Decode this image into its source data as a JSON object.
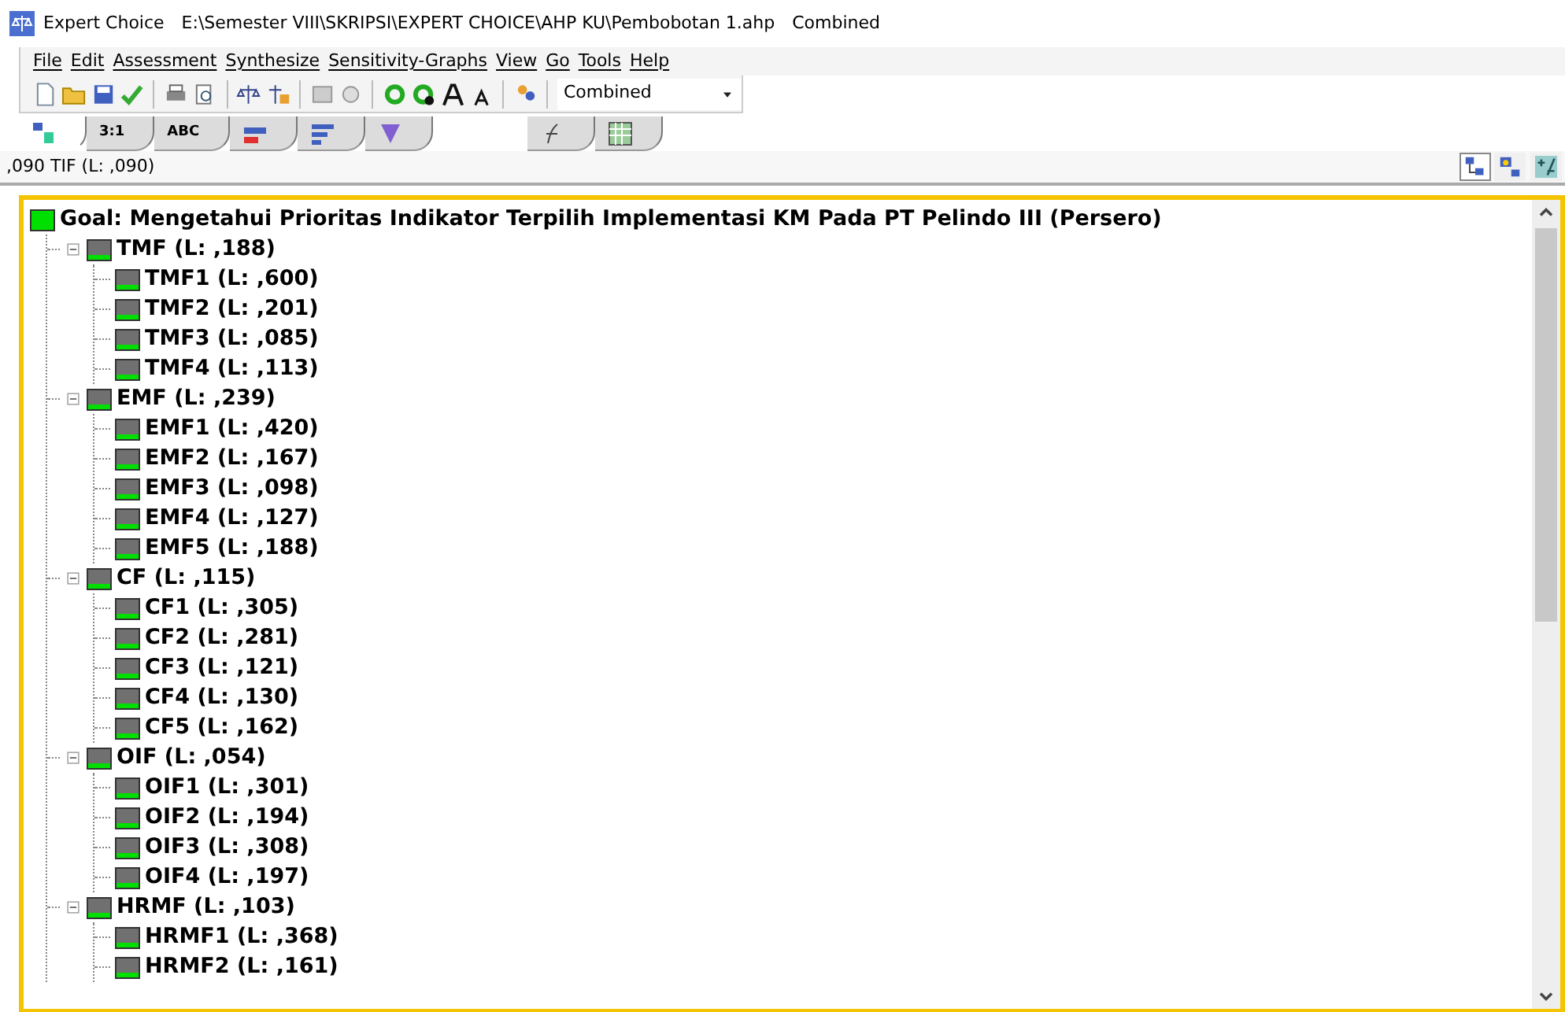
{
  "window": {
    "app": "Expert Choice",
    "path": "E:\\Semester VIII\\SKRIPSI\\EXPERT CHOICE\\AHP KU\\Pembobotan 1.ahp",
    "mode": "Combined"
  },
  "menu": [
    "File",
    "Edit",
    "Assessment",
    "Synthesize",
    "Sensitivity-Graphs",
    "View",
    "Go",
    "Tools",
    "Help"
  ],
  "toolbar": {
    "combo": "Combined"
  },
  "tabs": [
    {
      "kind": "icon",
      "selected": true
    },
    {
      "kind": "text",
      "label": "3:1",
      "selected": false
    },
    {
      "kind": "text",
      "label": "ABC",
      "selected": false
    },
    {
      "kind": "icon",
      "selected": false
    },
    {
      "kind": "icon",
      "selected": false
    },
    {
      "kind": "icon",
      "selected": false
    },
    {
      "kind": "icon",
      "selected": false
    },
    {
      "kind": "icon",
      "selected": false
    }
  ],
  "status": {
    "text": ",090 TIF (L: ,090)",
    "views": [
      {
        "selected": true
      },
      {
        "selected": false
      },
      {
        "selected": false
      }
    ]
  },
  "tree": {
    "label": "Goal: Mengetahui Prioritas Indikator Terpilih Implementasi KM Pada PT Pelindo III (Persero)",
    "children": [
      {
        "label": "TMF (L: ,188)",
        "expanded": true,
        "children": [
          {
            "label": "TMF1 (L: ,600)"
          },
          {
            "label": "TMF2 (L: ,201)"
          },
          {
            "label": "TMF3 (L: ,085)"
          },
          {
            "label": "TMF4 (L: ,113)"
          }
        ]
      },
      {
        "label": "EMF (L: ,239)",
        "expanded": true,
        "children": [
          {
            "label": "EMF1 (L: ,420)"
          },
          {
            "label": "EMF2 (L: ,167)"
          },
          {
            "label": "EMF3 (L: ,098)"
          },
          {
            "label": "EMF4 (L: ,127)"
          },
          {
            "label": "EMF5 (L: ,188)"
          }
        ]
      },
      {
        "label": "CF (L: ,115)",
        "expanded": true,
        "children": [
          {
            "label": "CF1 (L: ,305)"
          },
          {
            "label": "CF2 (L: ,281)"
          },
          {
            "label": "CF3 (L: ,121)"
          },
          {
            "label": "CF4 (L: ,130)"
          },
          {
            "label": "CF5 (L: ,162)"
          }
        ]
      },
      {
        "label": "OIF (L: ,054)",
        "expanded": true,
        "children": [
          {
            "label": "OIF1 (L: ,301)"
          },
          {
            "label": "OIF2 (L: ,194)"
          },
          {
            "label": "OIF3 (L: ,308)"
          },
          {
            "label": "OIF4 (L: ,197)"
          }
        ]
      },
      {
        "label": "HRMF (L: ,103)",
        "expanded": true,
        "children": [
          {
            "label": "HRMF1 (L: ,368)"
          },
          {
            "label": "HRMF2 (L: ,161)"
          }
        ]
      }
    ]
  }
}
